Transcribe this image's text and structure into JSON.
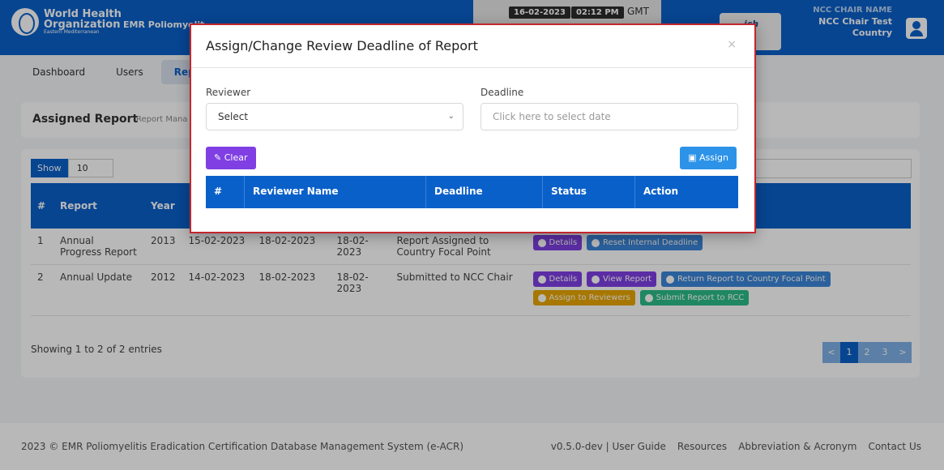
{
  "header": {
    "logo_line1": "World Health",
    "logo_line2": "Organization",
    "logo_line3": "Eastern Mediterranean",
    "app_name": "EMR Poliomyelit",
    "date": "16-02-2023",
    "time": "02:12 PM",
    "timezone": "GMT",
    "switch_line1": "ich",
    "switch_line2": "e",
    "user_role_label": "NCC CHAIR NAME",
    "user_name": "NCC Chair Test",
    "user_scope": "Country"
  },
  "nav": {
    "items": [
      "Dashboard",
      "Users",
      "Rep"
    ]
  },
  "assigned_card": {
    "title": "Assigned Report",
    "breadcrumb": "Report Mana"
  },
  "table": {
    "show_label": "Show",
    "show_value": "10",
    "headers": [
      "#",
      "Report",
      "Year",
      "",
      "",
      "",
      "",
      ""
    ],
    "rows": [
      {
        "num": "1",
        "report": "Annual Progress Report",
        "year": "2013",
        "d1": "15-02-2023",
        "d2": "18-02-2023",
        "d3": "18-02-2023",
        "status": "Report Assigned to Country Focal Point",
        "actions": [
          "Details",
          "Reset Internal Deadline"
        ]
      },
      {
        "num": "2",
        "report": "Annual Update",
        "year": "2012",
        "d1": "14-02-2023",
        "d2": "18-02-2023",
        "d3": "18-02-2023",
        "status": "Submitted to NCC Chair",
        "actions": [
          "Details",
          "View Report",
          "Return Report to Country Focal Point",
          "Assign to Reviewers",
          "Submit Report to RCC"
        ]
      }
    ],
    "showing": "Showing 1 to 2 of 2 entries",
    "pages": [
      "<",
      "1",
      "2",
      "3",
      ">"
    ]
  },
  "footer": {
    "left": "2023 ©  EMR Poliomyelitis Eradication Certification Database Management System (e-ACR)",
    "links": [
      "v0.5.0-dev  |  User Guide",
      "Resources",
      "Abbreviation & Acronym",
      "Contact Us"
    ]
  },
  "modal": {
    "title": "Assign/Change Review Deadline of Report",
    "close": "×",
    "reviewer_label": "Reviewer",
    "reviewer_value": "Select",
    "deadline_label": "Deadline",
    "deadline_placeholder": "Click here to select date",
    "clear_label": "Clear",
    "assign_label": "Assign",
    "columns": [
      "#",
      "Reviewer Name",
      "Deadline",
      "Status",
      "Action"
    ]
  },
  "colors": {
    "primary": "#0a60c9",
    "modal_border": "#c3262e",
    "purple": "#7f3fe3"
  }
}
